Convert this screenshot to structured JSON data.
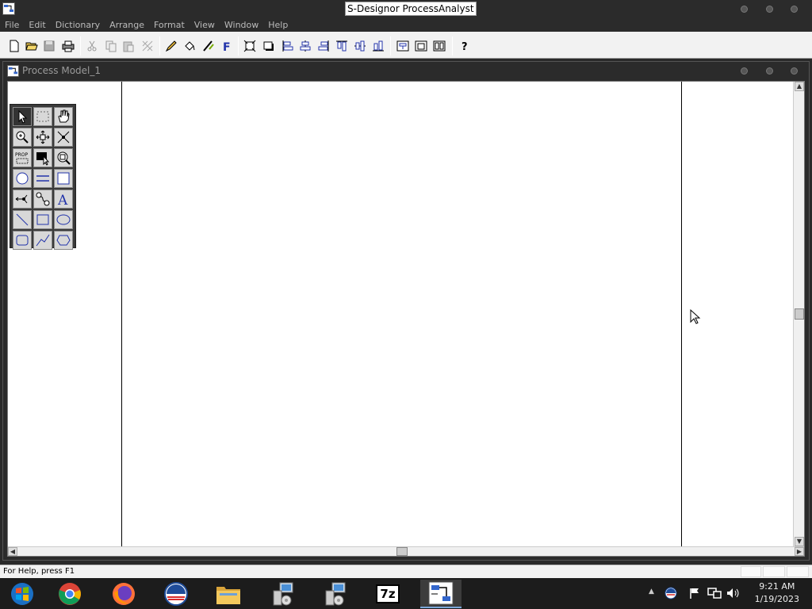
{
  "app": {
    "title": "S-Designor ProcessAnalyst"
  },
  "menu": [
    "File",
    "Edit",
    "Dictionary",
    "Arrange",
    "Format",
    "View",
    "Window",
    "Help"
  ],
  "toolbar": {
    "icons": [
      "new-file-icon",
      "open-folder-icon",
      "save-icon",
      "print-icon",
      "cut-icon",
      "copy-icon",
      "paste-icon",
      "delete-icon",
      "pencil-icon",
      "paint-bucket-icon",
      "line-style-icon",
      "font-icon",
      "zoom-fit-icon",
      "shadow-icon",
      "align-left-icon",
      "align-center-icon",
      "align-right-icon",
      "align-top-icon",
      "align-middle-icon",
      "align-bottom-icon",
      "group-icon",
      "page-icon",
      "tile-icon",
      "help-icon"
    ]
  },
  "document": {
    "title": "Process Model_1"
  },
  "palette": {
    "tools": [
      "pointer-icon",
      "marquee-select-icon",
      "hand-pan-icon",
      "zoom-in-icon",
      "move-icon",
      "resize-icon",
      "properties-icon",
      "fill-format-icon",
      "zoom-area-icon",
      "process-circle-icon",
      "data-store-icon",
      "external-entity-icon",
      "flow-icon",
      "connector-icon",
      "text-icon",
      "line-icon",
      "rectangle-icon",
      "ellipse-icon",
      "rounded-rect-icon",
      "polyline-icon",
      "polygon-icon"
    ]
  },
  "status": {
    "message": "For Help, press F1"
  },
  "taskbar": {
    "apps": [
      "windows-start-icon",
      "chrome-icon",
      "firefox-icon",
      "obama-logo-icon",
      "file-explorer-icon",
      "network-setup-icon",
      "network-setup-2-icon",
      "7zip-icon",
      "processanalyst-icon"
    ],
    "app7z_label": "7z",
    "time": "9:21 AM",
    "date": "1/19/2023"
  },
  "colors": {
    "accent": "#7aa7d8",
    "chrome_bg": "#2b2b2b"
  }
}
